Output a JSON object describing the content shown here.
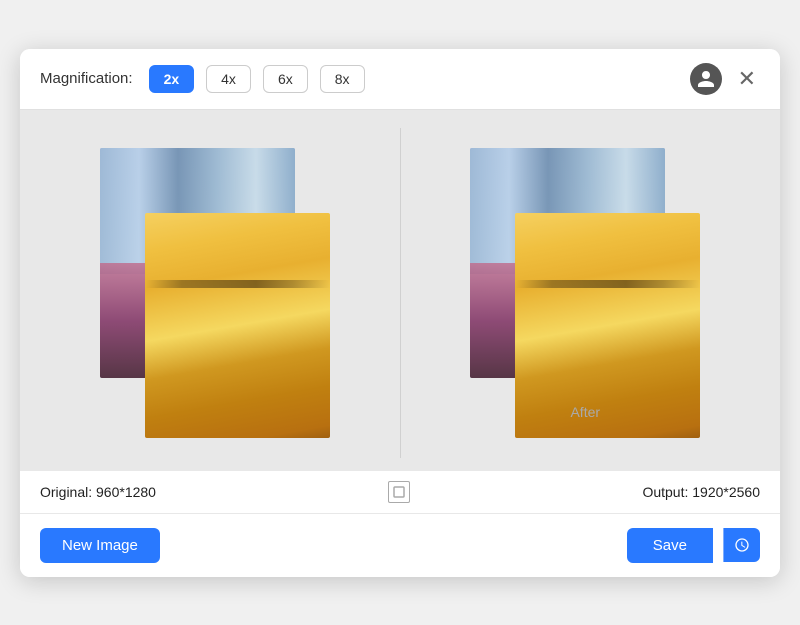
{
  "header": {
    "magnification_label": "Magnification:",
    "mag_buttons": [
      {
        "label": "2x",
        "active": true
      },
      {
        "label": "4x",
        "active": false
      },
      {
        "label": "6x",
        "active": false
      },
      {
        "label": "8x",
        "active": false
      }
    ]
  },
  "image_area": {
    "after_label": "After"
  },
  "status": {
    "original": "Original: 960*1280",
    "output": "Output: 1920*2560"
  },
  "footer": {
    "new_image_label": "New Image",
    "save_label": "Save"
  }
}
